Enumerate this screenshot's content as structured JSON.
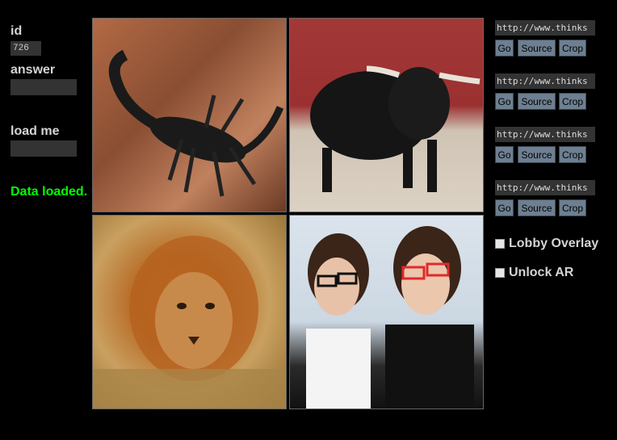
{
  "left": {
    "id_label": "id",
    "id_value": "726",
    "answer_label": "answer",
    "answer_value": "",
    "loadme_label": "load me",
    "loadme_value": "",
    "status": "Data loaded."
  },
  "images": [
    {
      "name": "scorpion-image"
    },
    {
      "name": "bull-image"
    },
    {
      "name": "lion-image"
    },
    {
      "name": "two-women-glasses-image"
    }
  ],
  "sources": [
    {
      "url": "http://www.thinks",
      "go": "Go",
      "source": "Source",
      "crop": "Crop"
    },
    {
      "url": "http://www.thinks",
      "go": "Go",
      "source": "Source",
      "crop": "Crop"
    },
    {
      "url": "http://www.thinks",
      "go": "Go",
      "source": "Source",
      "crop": "Crop"
    },
    {
      "url": "http://www.thinks",
      "go": "Go",
      "source": "Source",
      "crop": "Crop"
    }
  ],
  "options": {
    "lobby_overlay": "Lobby Overlay",
    "unlock_ar": "Unlock AR"
  }
}
